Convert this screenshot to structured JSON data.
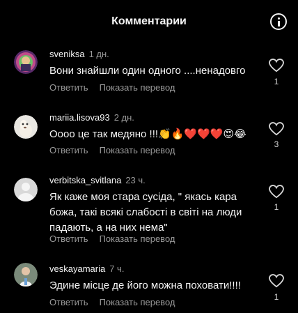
{
  "header": {
    "title": "Комментарии"
  },
  "labels": {
    "reply": "Ответить",
    "translate": "Показать перевод"
  },
  "comments": [
    {
      "username": "sveniksa",
      "time": "1 дн.",
      "text": "Вони знайшли один одного ....ненадовго",
      "likes": "1"
    },
    {
      "username": "mariia.lisova93",
      "time": "2 дн.",
      "text": "Оооо це так медяно !!!👏🔥❤️❤️❤️😍😂",
      "likes": "3"
    },
    {
      "username": "verbitska_svitlana",
      "time": "23 ч.",
      "text": "Як каже моя стара сусіда, \" якась кара божа, такі всякі слабості в світі на люди падають, а на них нема\"",
      "likes": "1"
    },
    {
      "username": "veskayamaria",
      "time": "7 ч.",
      "text": "Эдине місце де його можна поховати!!!!",
      "likes": "1"
    }
  ]
}
